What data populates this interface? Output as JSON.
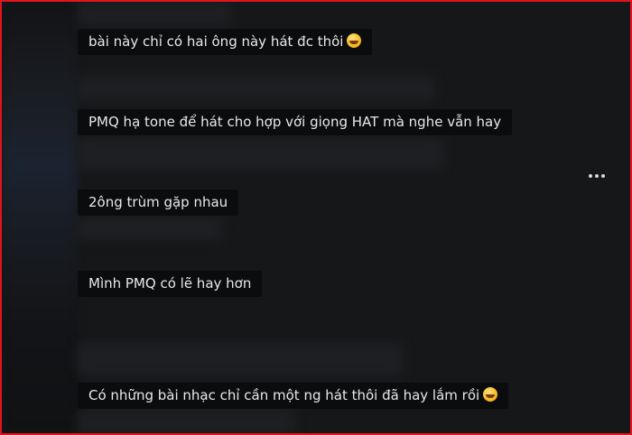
{
  "comments": [
    {
      "text": "bài này chỉ có hai ông này hát đc thôi",
      "emoji": "sweat-smile-emoji"
    },
    {
      "text": "PMQ hạ tone để hát cho hợp với giọng HAT mà nghe vẫn hay",
      "emoji": ""
    },
    {
      "text": "2ông trùm gặp nhau",
      "emoji": ""
    },
    {
      "text": "Mình PMQ có lẽ hay hơn",
      "emoji": ""
    },
    {
      "text": "Có những bài nhạc chỉ cần một ng hát thôi đã hay lắm rồi",
      "emoji": "grin-emoji"
    }
  ],
  "colors": {
    "frame_border": "#e0141e",
    "background": "#161719",
    "comment_bg": "#0b0c0d",
    "text": "#e8e8e8"
  },
  "icons": {
    "more": "more-horizontal-icon"
  }
}
